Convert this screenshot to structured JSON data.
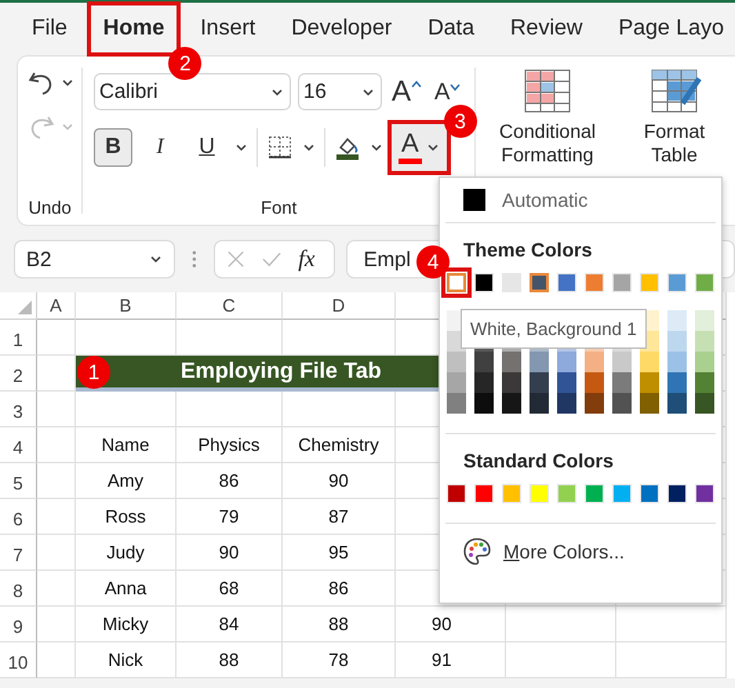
{
  "tabs": [
    {
      "label": "File",
      "selected": false
    },
    {
      "label": "Home",
      "selected": true,
      "callout": "2"
    },
    {
      "label": "Insert",
      "selected": false
    },
    {
      "label": "Developer",
      "selected": false
    },
    {
      "label": "Data",
      "selected": false
    },
    {
      "label": "Review",
      "selected": false
    },
    {
      "label": "Page Layo",
      "selected": false
    }
  ],
  "ribbon": {
    "undo_group": {
      "label": "Undo",
      "redo_disabled": true
    },
    "font_group": {
      "label": "Font",
      "font_name": "Calibri",
      "font_size": "16",
      "grow_font": "A",
      "shrink_font": "A",
      "styles": [
        {
          "label": "B",
          "kind": "bold",
          "on": true
        },
        {
          "label": "I",
          "kind": "italic",
          "on": false
        },
        {
          "label": "U",
          "kind": "underline",
          "on": false
        }
      ],
      "font_color": {
        "label": "A",
        "callout": "3"
      }
    },
    "commands": [
      {
        "kind": "conditional",
        "lines": [
          "Conditional",
          "Formatting"
        ]
      },
      {
        "kind": "table",
        "lines": [
          "Format",
          "Table"
        ]
      }
    ]
  },
  "formula_bar": {
    "name_box": "B2",
    "fx": "fx",
    "value": "Empl"
  },
  "sheet": {
    "columns": [
      {
        "label": "A"
      },
      {
        "label": "B"
      },
      {
        "label": "C"
      },
      {
        "label": "D"
      }
    ],
    "rows": [
      {
        "number": "1",
        "cells": {}
      },
      {
        "number": "2",
        "title": {
          "text": "Employing File Tab",
          "callout": "1"
        },
        "cells": {}
      },
      {
        "number": "3",
        "cells": {}
      },
      {
        "number": "4",
        "cells": {
          "b": "Name",
          "c": "Physics",
          "d": "Chemistry"
        }
      },
      {
        "number": "5",
        "cells": {
          "b": "Amy",
          "c": "86",
          "d": "90"
        }
      },
      {
        "number": "6",
        "cells": {
          "b": "Ross",
          "c": "79",
          "d": "87"
        }
      },
      {
        "number": "7",
        "cells": {
          "b": "Judy",
          "c": "90",
          "d": "95"
        }
      },
      {
        "number": "8",
        "cells": {
          "b": "Anna",
          "c": "68",
          "d": "86"
        }
      },
      {
        "number": "9",
        "cells": {
          "b": "Micky",
          "c": "84",
          "d": "88",
          "e": "90"
        }
      },
      {
        "number": "10",
        "cells": {
          "b": "Nick",
          "c": "88",
          "d": "78",
          "e": "91"
        }
      }
    ]
  },
  "font_color_menu": {
    "automatic": "Automatic",
    "theme_title": "Theme Colors",
    "theme_colors": [
      {
        "color": "#ffffff",
        "selected": true,
        "callout": "4"
      },
      {
        "color": "#000000",
        "selected": false
      },
      {
        "color": "#e7e6e6",
        "selected": false
      },
      {
        "color": "#44546a",
        "selected": true
      },
      {
        "color": "#4472c4",
        "selected": false
      },
      {
        "color": "#ed7d31",
        "selected": false
      },
      {
        "color": "#a5a5a5",
        "selected": false
      },
      {
        "color": "#ffc000",
        "selected": false
      },
      {
        "color": "#5b9bd5",
        "selected": false
      },
      {
        "color": "#70ad47",
        "selected": false
      }
    ],
    "shade_columns": [
      {
        "shades": [
          {
            "color": "#f2f2f2"
          },
          {
            "color": "#d9d9d9"
          },
          {
            "color": "#bfbfbf"
          },
          {
            "color": "#a6a6a6"
          },
          {
            "color": "#808080"
          }
        ]
      },
      {
        "shades": [
          {
            "color": "#595959"
          },
          {
            "color": "#404040"
          },
          {
            "color": "#262626"
          },
          {
            "color": "#0d0d0d"
          }
        ]
      },
      {
        "shades": [
          {
            "color": "#aeabab"
          },
          {
            "color": "#757171"
          },
          {
            "color": "#3a3838"
          },
          {
            "color": "#171616"
          }
        ]
      },
      {
        "shades": [
          {
            "color": "#acb9ca"
          },
          {
            "color": "#8497b0"
          },
          {
            "color": "#333f4f"
          },
          {
            "color": "#222b35"
          }
        ]
      },
      {
        "shades": [
          {
            "color": "#b4c6e7"
          },
          {
            "color": "#8ea9db"
          },
          {
            "color": "#305496"
          },
          {
            "color": "#203764"
          }
        ]
      },
      {
        "shades": [
          {
            "color": "#f8cbad"
          },
          {
            "color": "#f4b084"
          },
          {
            "color": "#c65911"
          },
          {
            "color": "#833c0c"
          }
        ]
      },
      {
        "shades": [
          {
            "color": "#dbdbdb"
          },
          {
            "color": "#c9c9c9"
          },
          {
            "color": "#7b7b7b"
          },
          {
            "color": "#525252"
          }
        ]
      },
      {
        "shades": [
          {
            "color": "#fff2cc"
          },
          {
            "color": "#ffe699"
          },
          {
            "color": "#ffd966"
          },
          {
            "color": "#bf8f00"
          },
          {
            "color": "#806000"
          }
        ]
      },
      {
        "shades": [
          {
            "color": "#ddebf7"
          },
          {
            "color": "#bdd7ee"
          },
          {
            "color": "#9bc2e6"
          },
          {
            "color": "#2f75b5"
          },
          {
            "color": "#1f4e78"
          }
        ]
      },
      {
        "shades": [
          {
            "color": "#e2efda"
          },
          {
            "color": "#c6e0b4"
          },
          {
            "color": "#a9d08e"
          },
          {
            "color": "#548235"
          },
          {
            "color": "#375623"
          }
        ]
      }
    ],
    "tooltip": "White, Background 1",
    "standard_title": "Standard Colors",
    "standard_colors": [
      {
        "color": "#c00000"
      },
      {
        "color": "#ff0000"
      },
      {
        "color": "#ffc000"
      },
      {
        "color": "#ffff00"
      },
      {
        "color": "#92d050"
      },
      {
        "color": "#00b050"
      },
      {
        "color": "#00b0f0"
      },
      {
        "color": "#0070c0"
      },
      {
        "color": "#002060"
      },
      {
        "color": "#7030a0"
      }
    ],
    "more_colors": "More Colors..."
  }
}
